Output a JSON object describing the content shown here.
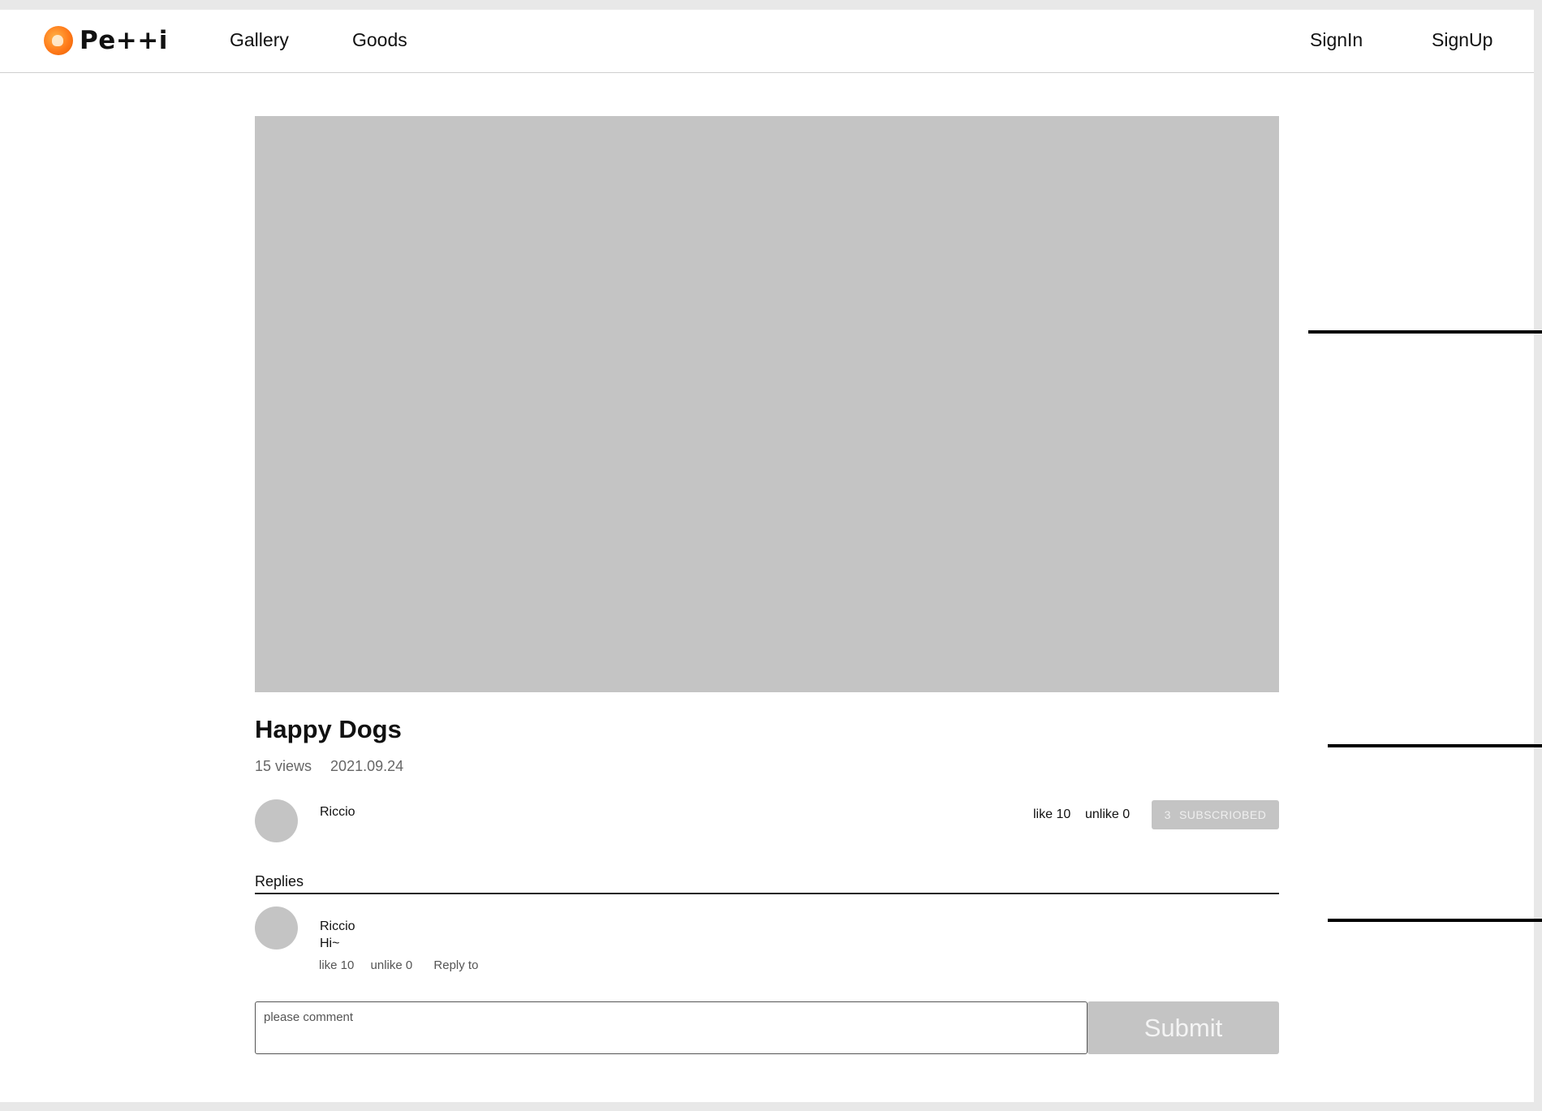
{
  "header": {
    "brand": "Pe++i",
    "nav": [
      "Gallery",
      "Goods"
    ],
    "auth": {
      "signin": "SignIn",
      "signup": "SignUp"
    }
  },
  "post": {
    "title": "Happy Dogs",
    "views": "15 views",
    "date": "2021.09.24",
    "author": "Riccio",
    "like": "like 10",
    "unlike": "unlike 0",
    "subscribe_count": "3",
    "subscribe_label": "SUBSCRIOBED"
  },
  "replies": {
    "label": "Replies",
    "items": [
      {
        "author": "Riccio",
        "text": "Hi~",
        "like": "like 10",
        "unlike": "unlike 0",
        "reply": "Reply to"
      }
    ]
  },
  "comment": {
    "placeholder": "please comment",
    "submit": "Submit"
  },
  "colors": {
    "placeholder_gray": "#c4c4c4",
    "brand_orange": "#ff7a1a"
  }
}
